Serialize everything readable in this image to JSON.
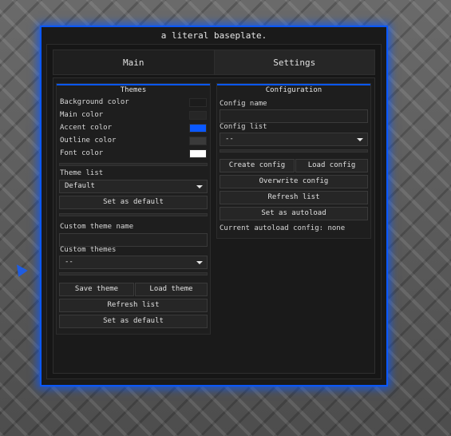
{
  "window": {
    "title": "a literal baseplate.",
    "accent": "#0a58ff"
  },
  "tabs": [
    {
      "label": "Main"
    },
    {
      "label": "Settings"
    }
  ],
  "themes": {
    "header": "Themes",
    "colors": [
      {
        "label": "Background color",
        "value": "#1c1c1c"
      },
      {
        "label": "Main color",
        "value": "#262626"
      },
      {
        "label": "Accent color",
        "value": "#0a58ff"
      },
      {
        "label": "Outline color",
        "value": "#3a3a3a"
      },
      {
        "label": "Font color",
        "value": "#ffffff"
      }
    ],
    "theme_list_label": "Theme list",
    "theme_list_value": "Default",
    "set_default_1": "Set as default",
    "custom_name_label": "Custom theme name",
    "custom_name_value": "",
    "custom_themes_label": "Custom themes",
    "custom_themes_value": "--",
    "save_theme": "Save theme",
    "load_theme": "Load theme",
    "refresh_list": "Refresh list",
    "set_default_2": "Set as default"
  },
  "config": {
    "header": "Configuration",
    "config_name_label": "Config name",
    "config_name_value": "",
    "config_list_label": "Config list",
    "config_list_value": "--",
    "create": "Create config",
    "load": "Load config",
    "overwrite": "Overwrite config",
    "refresh": "Refresh list",
    "autoload": "Set as autoload",
    "current_autoload": "Current autoload config: none"
  }
}
